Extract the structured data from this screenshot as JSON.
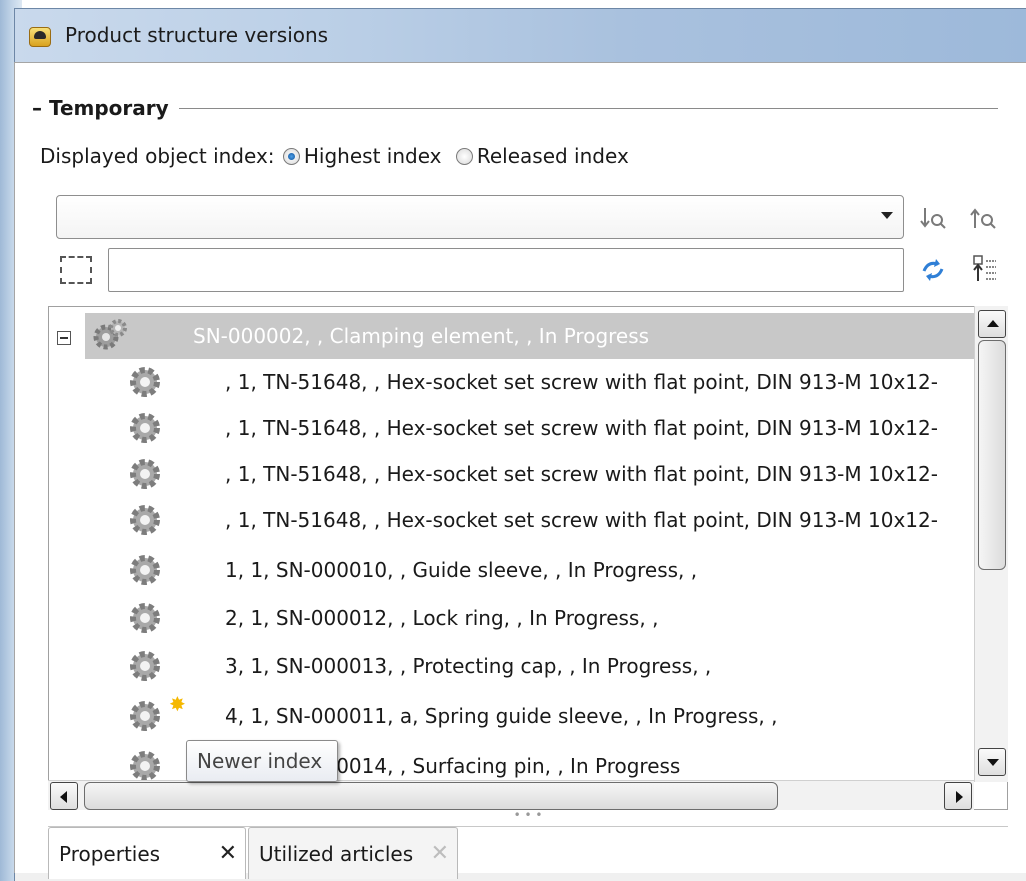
{
  "window": {
    "title": "Product structure versions",
    "title_icon": "app-icon"
  },
  "group": {
    "label": "Temporary"
  },
  "index_selector": {
    "label": "Displayed object index:",
    "options": [
      {
        "label": "Highest index",
        "checked": true
      },
      {
        "label": "Released index",
        "checked": false
      }
    ]
  },
  "search": {
    "combo_value": "",
    "filter_value": ""
  },
  "toolbar_icons": [
    "sort-down-search-icon",
    "sort-up-search-icon",
    "refresh-arrows-icon",
    "column-settings-icon"
  ],
  "tree": {
    "root": {
      "label": "SN-000002, , Clamping element, , In Progress",
      "expanded": true,
      "selected": true
    },
    "children": [
      {
        "label": ", 1, TN-51648, , Hex-socket set screw with flat point, DIN 913-M 10x12-"
      },
      {
        "label": ", 1, TN-51648, , Hex-socket set screw with flat point, DIN 913-M 10x12-"
      },
      {
        "label": ", 1, TN-51648, , Hex-socket set screw with flat point, DIN 913-M 10x12-"
      },
      {
        "label": ", 1, TN-51648, , Hex-socket set screw with flat point, DIN 913-M 10x12-"
      },
      {
        "label": "1, 1, SN-000010, , Guide sleeve, , In Progress, ,"
      },
      {
        "label": "2, 1, SN-000012, , Lock ring, , In Progress, ,"
      },
      {
        "label": "3, 1, SN-000013, , Protecting cap, , In Progress, ,"
      },
      {
        "label": "4, 1, SN-000011, a, Spring guide sleeve, , In Progress, ,",
        "newer_index": true
      },
      {
        "label": "5, 1, SN-000014, , Surfacing pin, , In Progress"
      }
    ]
  },
  "tooltip": {
    "text": "Newer index"
  },
  "tabs": [
    {
      "label": "Properties",
      "close": "✕",
      "active": true
    },
    {
      "label": "Utilized articles",
      "close": "✕",
      "active": false
    }
  ],
  "colors": {
    "selection": "#c8c8c8",
    "radio_checked": "#1f6fc8",
    "star": "#f5b800"
  }
}
